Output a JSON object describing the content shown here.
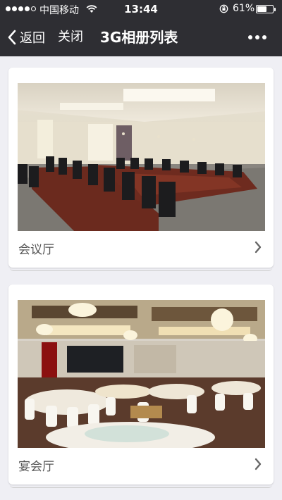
{
  "status_bar": {
    "carrier": "中国移动",
    "time": "13:44",
    "battery": "61%",
    "battery_level": 0.61
  },
  "nav": {
    "back_label": "返回",
    "close_label": "关闭",
    "title": "3G相册列表"
  },
  "albums": [
    {
      "caption": "会议厅",
      "photo_icon": "conference-room-photo"
    },
    {
      "caption": "宴会厅",
      "photo_icon": "banquet-hall-photo"
    }
  ],
  "colors": {
    "bar_bg": "#2e2e33",
    "page_bg": "#efeff4"
  }
}
